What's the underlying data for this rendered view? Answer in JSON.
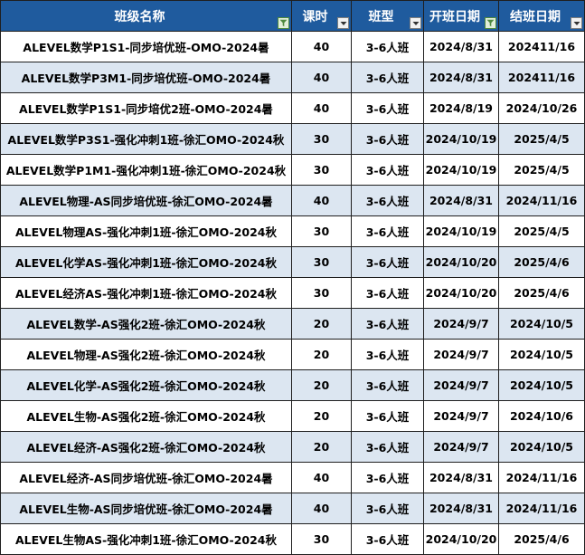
{
  "table": {
    "headers": [
      "班级名称",
      "课时",
      "班型",
      "开班日期",
      "结班日期"
    ],
    "filter_active": [
      true,
      false,
      false,
      true,
      false
    ],
    "rows": [
      [
        "ALEVEL数学P1S1-同步培优班-OMO-2024暑",
        "40",
        "3-6人班",
        "2024/8/31",
        "202411/16"
      ],
      [
        "ALEVEL数学P3M1-同步培优班-OMO-2024暑",
        "40",
        "3-6人班",
        "2024/8/31",
        "202411/16"
      ],
      [
        "ALEVEL数学P1S1-同步培优2班-OMO-2024暑",
        "40",
        "3-6人班",
        "2024/8/19",
        "2024/10/26"
      ],
      [
        "ALEVEL数学P3S1-强化冲刺1班-徐汇OMO-2024秋",
        "30",
        "3-6人班",
        "2024/10/19",
        "2025/4/5"
      ],
      [
        "ALEVEL数学P1M1-强化冲刺1班-徐汇OMO-2024秋",
        "30",
        "3-6人班",
        "2024/10/19",
        "2025/4/5"
      ],
      [
        "ALEVEL物理-AS同步培优班-徐汇OMO-2024暑",
        "40",
        "3-6人班",
        "2024/8/31",
        "2024/11/16"
      ],
      [
        "ALEVEL物理AS-强化冲刺1班-徐汇OMO-2024秋",
        "30",
        "3-6人班",
        "2024/10/19",
        "2025/4/5"
      ],
      [
        "ALEVEL化学AS-强化冲刺1班-徐汇OMO-2024秋",
        "30",
        "3-6人班",
        "2024/10/20",
        "2025/4/6"
      ],
      [
        "ALEVEL经济AS-强化冲刺1班-徐汇OMO-2024秋",
        "30",
        "3-6人班",
        "2024/10/20",
        "2025/4/6"
      ],
      [
        "ALEVEL数学-AS强化2班-徐汇OMO-2024秋",
        "20",
        "3-6人班",
        "2024/9/7",
        "2024/10/5"
      ],
      [
        "ALEVEL物理-AS强化2班-徐汇OMO-2024秋",
        "20",
        "3-6人班",
        "2024/9/7",
        "2024/10/5"
      ],
      [
        "ALEVEL化学-AS强化2班-徐汇OMO-2024秋",
        "20",
        "3-6人班",
        "2024/9/7",
        "2024/10/5"
      ],
      [
        "ALEVEL生物-AS强化2班-徐汇OMO-2024秋",
        "20",
        "3-6人班",
        "2024/9/7",
        "2024/10/6"
      ],
      [
        "ALEVEL经济-AS强化2班-徐汇OMO-2024秋",
        "20",
        "3-6人班",
        "2024/9/7",
        "2024/10/5"
      ],
      [
        "ALEVEL经济-AS同步培优班-徐汇OMO-2024暑",
        "40",
        "3-6人班",
        "2024/8/31",
        "2024/11/16"
      ],
      [
        "ALEVEL生物-AS同步培优班-徐汇OMO-2024暑",
        "40",
        "3-6人班",
        "2024/8/31",
        "2024/11/16"
      ],
      [
        "ALEVEL生物AS-强化冲刺1班-徐汇OMO-2024秋",
        "30",
        "3-6人班",
        "2024/10/20",
        "2025/4/6"
      ]
    ]
  },
  "colors": {
    "header_bg": "#1f5b9e",
    "header_text": "#ffffff",
    "band_row": "#dce6f1",
    "plain_row": "#ffffff",
    "active_filter": "#4f8a3f"
  },
  "icons": {
    "dropdown": "chevron-down-icon",
    "active_filter": "filter-active-icon"
  }
}
